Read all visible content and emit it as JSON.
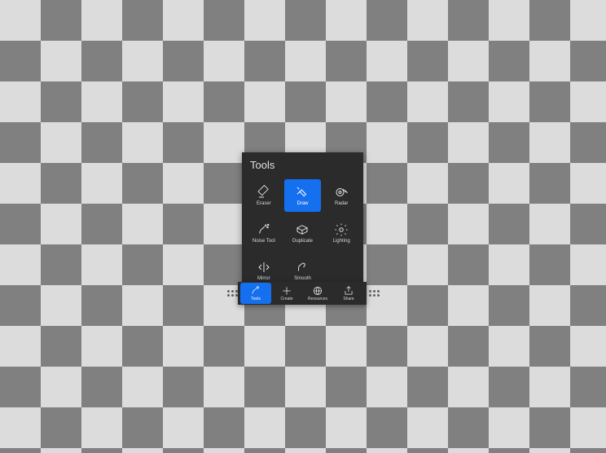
{
  "colors": {
    "accent": "#1570ef",
    "panel": "#2b2b2b",
    "checker_light": "#dcdcdc",
    "checker_dark": "#808080"
  },
  "tools_panel": {
    "title": "Tools",
    "items": [
      {
        "label": "Eraser",
        "icon": "eraser-icon",
        "selected": false
      },
      {
        "label": "Draw",
        "icon": "draw-icon",
        "selected": true
      },
      {
        "label": "Radar",
        "icon": "radar-icon",
        "selected": false
      },
      {
        "label": "Noise Tool",
        "icon": "noise-tool-icon",
        "selected": false
      },
      {
        "label": "Duplicate",
        "icon": "duplicate-icon",
        "selected": false
      },
      {
        "label": "Lighting",
        "icon": "lighting-icon",
        "selected": false
      },
      {
        "label": "Mirror",
        "icon": "mirror-icon",
        "selected": false
      },
      {
        "label": "Smooth",
        "icon": "smooth-icon",
        "selected": false
      }
    ]
  },
  "bottom_bar": {
    "items": [
      {
        "label": "Tools",
        "icon": "tools-tab-icon",
        "selected": true
      },
      {
        "label": "Create",
        "icon": "create-icon",
        "selected": false
      },
      {
        "label": "Resources",
        "icon": "globe-icon",
        "selected": false
      },
      {
        "label": "Share",
        "icon": "share-icon",
        "selected": false
      }
    ]
  }
}
